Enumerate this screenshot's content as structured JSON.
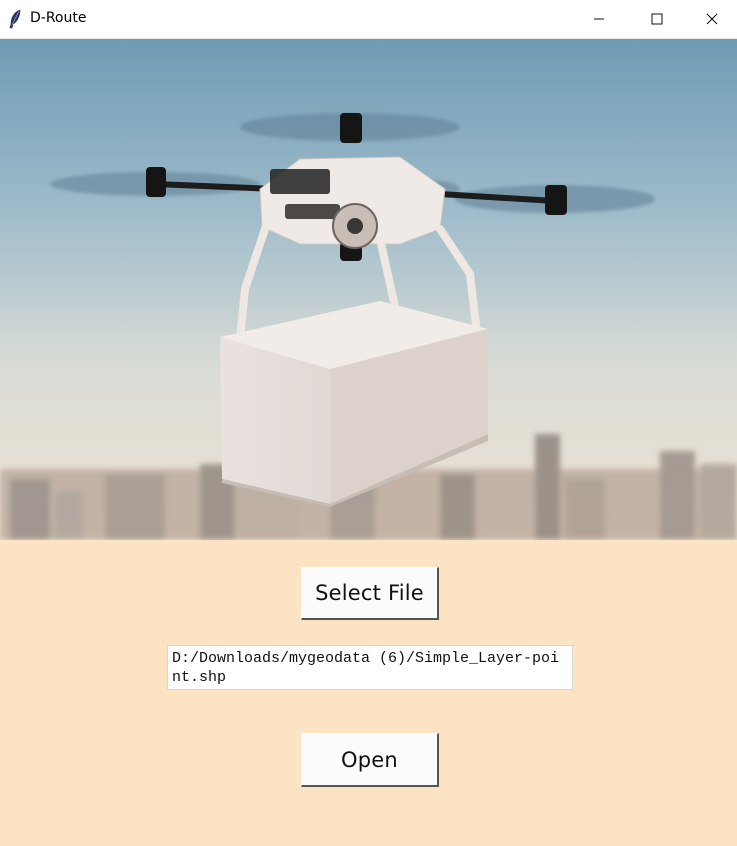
{
  "window": {
    "title": "D-Route",
    "app_icon": "feather-icon",
    "controls": {
      "minimize": "minimize-icon",
      "maximize": "maximize-icon",
      "close": "close-icon"
    }
  },
  "hero_image": {
    "icon": "delivery-drone-image"
  },
  "main": {
    "select_button_label": "Select File",
    "file_path": "D:/Downloads/mygeodata (6)/Simple_Layer-point.shp",
    "open_button_label": "Open"
  },
  "colors": {
    "background": "#fce3c3",
    "titlebar": "#ffffff",
    "button_face": "#fbfbfb"
  }
}
